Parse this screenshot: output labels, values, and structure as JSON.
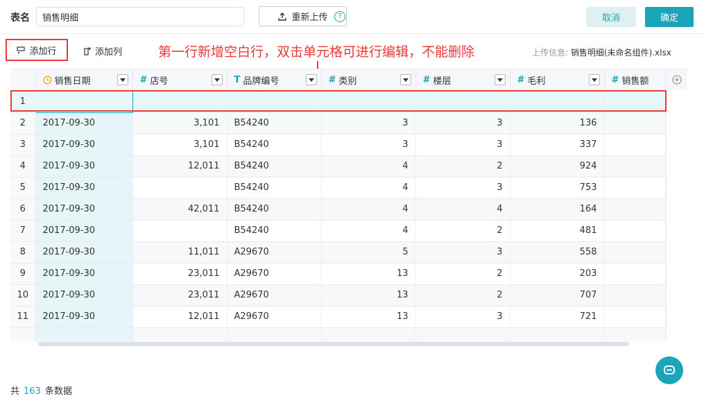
{
  "header": {
    "table_name_label": "表名",
    "table_name_value": "销售明细",
    "reupload_label": "重新上传",
    "help_glyph": "?",
    "cancel_label": "取消",
    "confirm_label": "确定"
  },
  "toolbar": {
    "add_row_label": "添加行",
    "add_col_label": "添加列",
    "annotation": "第一行新增空白行，双击单元格可进行编辑，不能删除",
    "upload_info_label": "上传信息:",
    "upload_info_file": "销售明细(未命名组件).xlsx"
  },
  "columns": [
    {
      "label": "销售日期",
      "type": "date"
    },
    {
      "label": "店号",
      "type": "number"
    },
    {
      "label": "品牌编号",
      "type": "text"
    },
    {
      "label": "类别",
      "type": "number"
    },
    {
      "label": "楼层",
      "type": "number"
    },
    {
      "label": "毛利",
      "type": "number"
    },
    {
      "label": "销售额",
      "type": "number"
    }
  ],
  "rows": [
    {
      "idx": "1",
      "cells": [
        "",
        "",
        "",
        "",
        "",
        "",
        ""
      ]
    },
    {
      "idx": "2",
      "cells": [
        "2017-09-30",
        "3,101",
        "B54240",
        "3",
        "3",
        "136",
        ""
      ]
    },
    {
      "idx": "3",
      "cells": [
        "2017-09-30",
        "3,101",
        "B54240",
        "3",
        "3",
        "337",
        ""
      ]
    },
    {
      "idx": "4",
      "cells": [
        "2017-09-30",
        "12,011",
        "B54240",
        "4",
        "2",
        "924",
        ""
      ]
    },
    {
      "idx": "5",
      "cells": [
        "2017-09-30",
        "",
        "B54240",
        "4",
        "3",
        "753",
        ""
      ]
    },
    {
      "idx": "6",
      "cells": [
        "2017-09-30",
        "42,011",
        "B54240",
        "4",
        "4",
        "164",
        ""
      ]
    },
    {
      "idx": "7",
      "cells": [
        "2017-09-30",
        "",
        "B54240",
        "4",
        "2",
        "481",
        ""
      ]
    },
    {
      "idx": "8",
      "cells": [
        "2017-09-30",
        "11,011",
        "A29670",
        "5",
        "3",
        "558",
        ""
      ]
    },
    {
      "idx": "9",
      "cells": [
        "2017-09-30",
        "23,011",
        "A29670",
        "13",
        "2",
        "203",
        ""
      ]
    },
    {
      "idx": "10",
      "cells": [
        "2017-09-30",
        "23,011",
        "A29670",
        "13",
        "2",
        "707",
        ""
      ]
    },
    {
      "idx": "11",
      "cells": [
        "2017-09-30",
        "12,011",
        "A29670",
        "13",
        "3",
        "721",
        ""
      ]
    },
    {
      "idx": "",
      "cells": [
        "",
        "",
        "",
        "",
        "",
        "",
        ""
      ]
    }
  ],
  "footer": {
    "prefix": "共",
    "count": "163",
    "suffix": "条数据"
  },
  "colors": {
    "accent": "#1aa5b8",
    "highlight_red": "#e83a3a"
  }
}
